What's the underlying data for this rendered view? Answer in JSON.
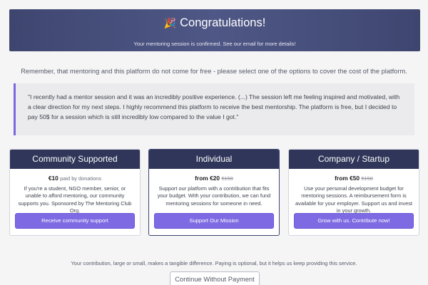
{
  "banner": {
    "emoji": "🎉",
    "title": "Congratulations!",
    "subtitle": "Your mentoring session is confirmed. See our email for more details!"
  },
  "remember_text": "Remember, that mentoring and this platform do not come for free - please select one of the options to cover the cost of the platform.",
  "testimonial": "\"I recently had a mentor session and it was an incredibly positive experience. (...) The session left me feeling inspired and motivated, with a clear direction for my next steps. I highly recommend this platform to receive the best mentorship. The platform is free, but I decided to pay 50$ for a session which is still incredibly low compared to the value I got.\"",
  "cards": [
    {
      "title": "Community Supported",
      "price": "€10",
      "price_note": "paid by donations",
      "price_old": "",
      "description": "If you're a student, NGO member, senior, or unable to afford mentoring, our community supports you. Sponsored by The Mentoring Club Org.",
      "button": "Receive community support"
    },
    {
      "title": "Individual",
      "price": "from €20",
      "price_note": "",
      "price_old": "€150",
      "description": "Support our platform with a contribution that fits your budget. With your contribution, we can fund mentoring sessions for someone in need.",
      "button": "Support Our Mission"
    },
    {
      "title": "Company / Startup",
      "price": "from €50",
      "price_note": "",
      "price_old": "€150",
      "description": "Use your personal development budget for mentoring sessions. A reimbursement form is available for your employer. Support us and invest in your growth.",
      "button": "Grow with us. Contribute now!"
    }
  ],
  "footer_text": "Your contribution, large or small, makes a tangible difference. Paying is optional, but it helps us keep providing this service.",
  "continue_button": "Continue Without Payment",
  "colors": {
    "banner": "#464e7b",
    "card_header": "#2f3659",
    "accent": "#7e6ae2",
    "quote_border": "#7b68e0"
  }
}
